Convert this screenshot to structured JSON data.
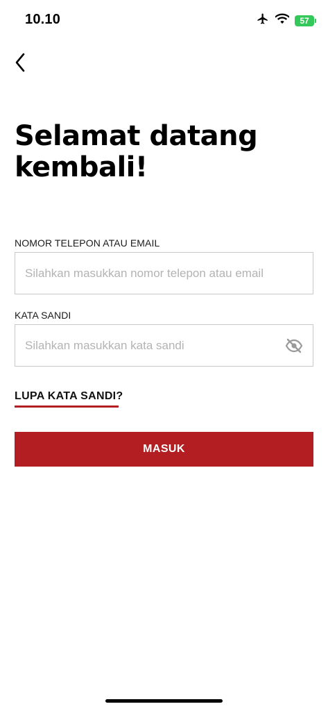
{
  "status_bar": {
    "time": "10.10",
    "battery_level": "57",
    "icons": [
      "airplane-icon",
      "wifi-icon",
      "battery-icon"
    ]
  },
  "header": {
    "back_icon": "chevron-left-icon"
  },
  "heading": {
    "line1": "Selamat datang",
    "line2": "kembali!"
  },
  "form": {
    "phone_email": {
      "label": "NOMOR TELEPON ATAU EMAIL",
      "placeholder": "Silahkan masukkan nomor telepon atau email",
      "value": ""
    },
    "password": {
      "label": "KATA SANDI",
      "placeholder": "Silahkan masukkan kata sandi",
      "value": "",
      "toggle_icon": "eye-off-icon"
    },
    "forgot_password_label": "LUPA KATA SANDI?",
    "submit_label": "MASUK"
  },
  "colors": {
    "accent": "#b31e22",
    "battery": "#34c759",
    "input_border": "#c8c8c8",
    "placeholder": "#b3b3b3"
  }
}
